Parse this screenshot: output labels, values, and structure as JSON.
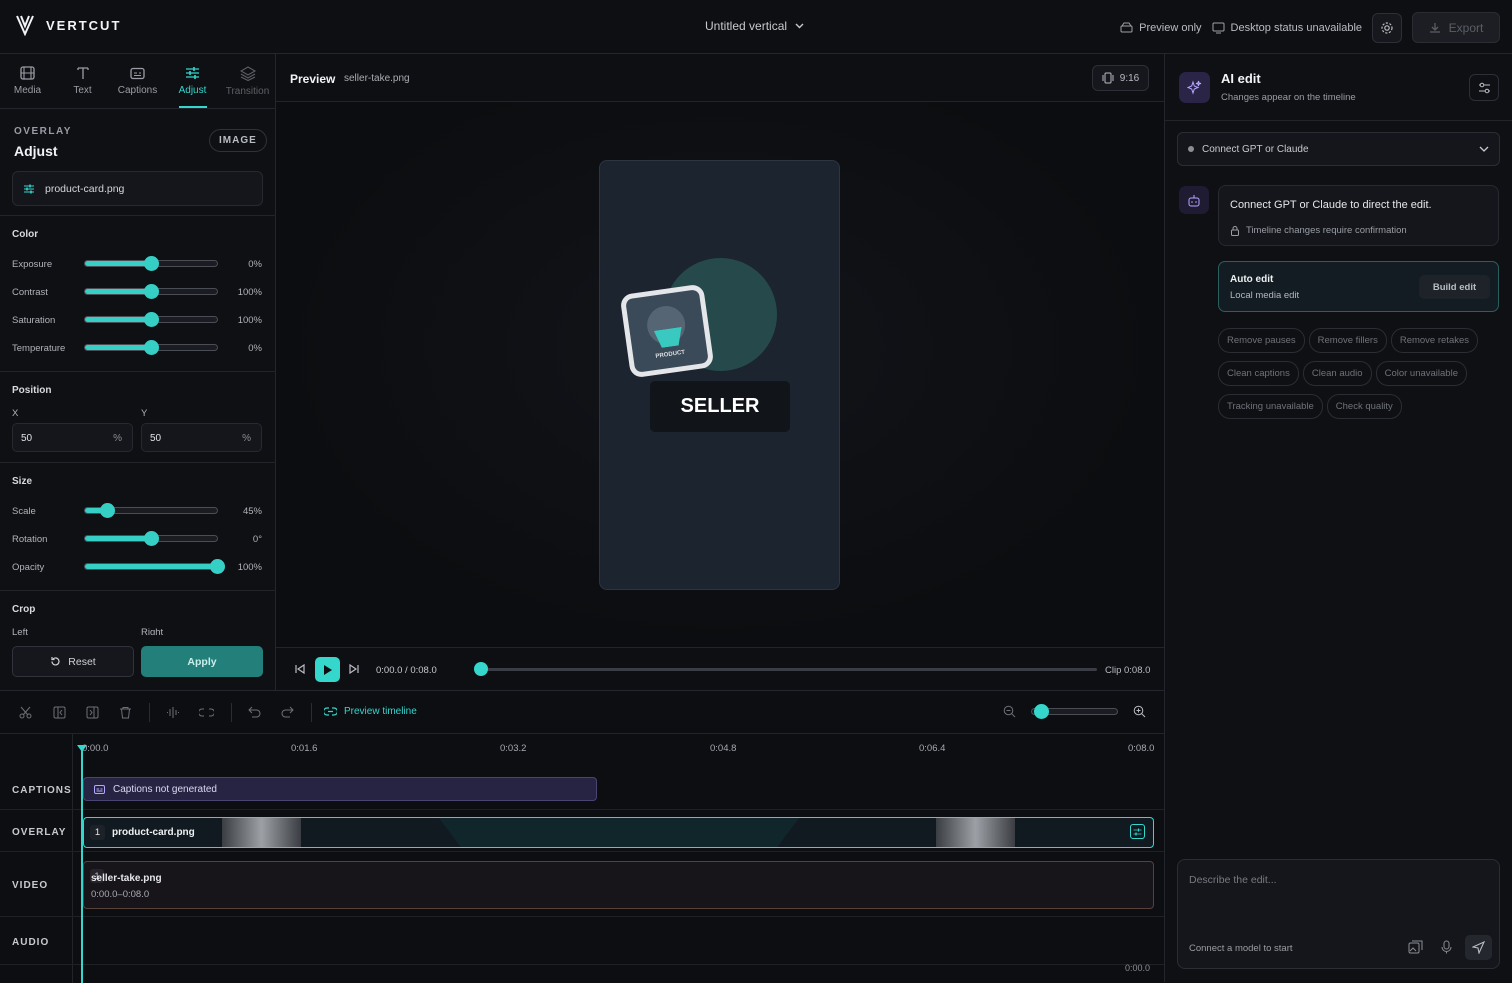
{
  "app": {
    "name": "VERTCUT",
    "project_title": "Untitled vertical"
  },
  "topbar": {
    "preview_status": "Preview only",
    "desktop_status": "Desktop status unavailable",
    "export_label": "Export"
  },
  "left_panel": {
    "tabs": [
      {
        "label": "Media",
        "icon": "film-icon"
      },
      {
        "label": "Text",
        "icon": "text-icon"
      },
      {
        "label": "Captions",
        "icon": "captions-icon"
      },
      {
        "label": "Adjust",
        "icon": "sliders-icon",
        "active": true
      },
      {
        "label": "Transition",
        "icon": "layers-icon"
      }
    ],
    "section_kicker": "OVERLAY",
    "section_title": "Adjust",
    "type_badge": "IMAGE",
    "file_name": "product-card.png",
    "color": {
      "title": "Color",
      "rows": [
        {
          "label": "Exposure",
          "value": "0%",
          "level": 0.5
        },
        {
          "label": "Contrast",
          "value": "100%",
          "level": 0.5
        },
        {
          "label": "Saturation",
          "value": "100%",
          "level": 0.5
        },
        {
          "label": "Temperature",
          "value": "0%",
          "level": 0.5
        }
      ]
    },
    "position": {
      "title": "Position",
      "x_label": "X",
      "x_value": "50",
      "y_label": "Y",
      "y_value": "50",
      "unit": "%"
    },
    "size": {
      "title": "Size",
      "rows": [
        {
          "label": "Scale",
          "value": "45%",
          "level": 0.17
        },
        {
          "label": "Rotation",
          "value": "0°",
          "level": 0.5
        },
        {
          "label": "Opacity",
          "value": "100%",
          "level": 1.0
        }
      ]
    },
    "crop": {
      "title": "Crop",
      "left_label": "Left",
      "right_label": "Right"
    },
    "reset_label": "Reset",
    "apply_label": "Apply"
  },
  "preview": {
    "title": "Preview",
    "file": "seller-take.png",
    "aspect": "9:16",
    "overlay_text": "PRODUCT",
    "caption_text": "SELLER",
    "time": "0:00.0 / 0:08.0",
    "clip": "Clip 0:08.0",
    "progress": 0
  },
  "ai_panel": {
    "title": "AI edit",
    "subtitle": "Changes appear on the timeline",
    "model_select": "Connect GPT or Claude",
    "message": "Connect GPT or Claude to direct the edit.",
    "message_note": "Timeline changes require confirmation",
    "auto_edit_title": "Auto edit",
    "auto_edit_sub": "Local media edit",
    "build_label": "Build edit",
    "chips": [
      "Remove pauses",
      "Remove fillers",
      "Remove retakes",
      "Clean captions",
      "Clean audio",
      "Color unavailable",
      "Tracking unavailable",
      "Check quality"
    ],
    "input_placeholder": "Describe the edit...",
    "input_hint": "Connect a model to start"
  },
  "timeline": {
    "preview_link": "Preview timeline",
    "zoom_level": 0.1,
    "ticks": [
      "0:00.0",
      "0:01.6",
      "0:03.2",
      "0:04.8",
      "0:06.4",
      "0:08.0"
    ],
    "tracks": {
      "captions": "CAPTIONS",
      "overlay": "OVERLAY",
      "video": "VIDEO",
      "audio": "AUDIO"
    },
    "captions_clip": "Captions not generated",
    "overlay_clip": {
      "index": "1",
      "name": "product-card.png"
    },
    "video_clip": {
      "index": "1",
      "name": "seller-take.png",
      "range": "0:00.0–0:08.0"
    },
    "audio_end": "0:00.0"
  },
  "colors": {
    "accent": "#35d6cc",
    "apply": "#237f7a",
    "caption_clip": "#272342"
  }
}
